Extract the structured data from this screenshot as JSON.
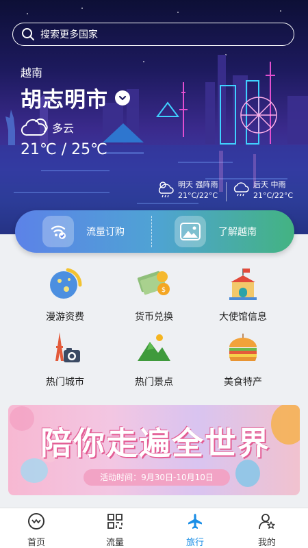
{
  "search": {
    "placeholder": "搜索更多国家"
  },
  "location": {
    "country": "越南",
    "city": "胡志明市"
  },
  "weather": {
    "now": {
      "condition": "多云",
      "temp": "21℃ / 25℃"
    },
    "forecast": [
      {
        "label": "明天 强阵雨",
        "temp": "21°C/22°C",
        "icon": "rain-cloud-icon"
      },
      {
        "label": "后天 中雨",
        "temp": "21°C/22°C",
        "icon": "rain-cloud-icon"
      }
    ]
  },
  "quick": {
    "subscribe": "流量订购",
    "learn": "了解越南"
  },
  "grid": [
    {
      "label": "漫游资费",
      "icon": "roaming-planet-icon"
    },
    {
      "label": "货币兑换",
      "icon": "money-exchange-icon"
    },
    {
      "label": "大使馆信息",
      "icon": "embassy-icon"
    },
    {
      "label": "热门城市",
      "icon": "eiffel-camera-icon"
    },
    {
      "label": "热门景点",
      "icon": "mountain-sun-icon"
    },
    {
      "label": "美食特产",
      "icon": "burger-icon"
    }
  ],
  "banner": {
    "title": "陪你走遍全世界",
    "date": "活动时间：9月30日-10月10日"
  },
  "tabs": [
    {
      "label": "首页",
      "icon": "home-smile-icon",
      "active": false
    },
    {
      "label": "流量",
      "icon": "data-grid-icon",
      "active": false
    },
    {
      "label": "旅行",
      "icon": "plane-icon",
      "active": true
    },
    {
      "label": "我的",
      "icon": "user-star-icon",
      "active": false
    }
  ],
  "colors": {
    "accent": "#1b8ee6",
    "quick_left": "#5c82e8",
    "quick_right": "#43b382"
  }
}
